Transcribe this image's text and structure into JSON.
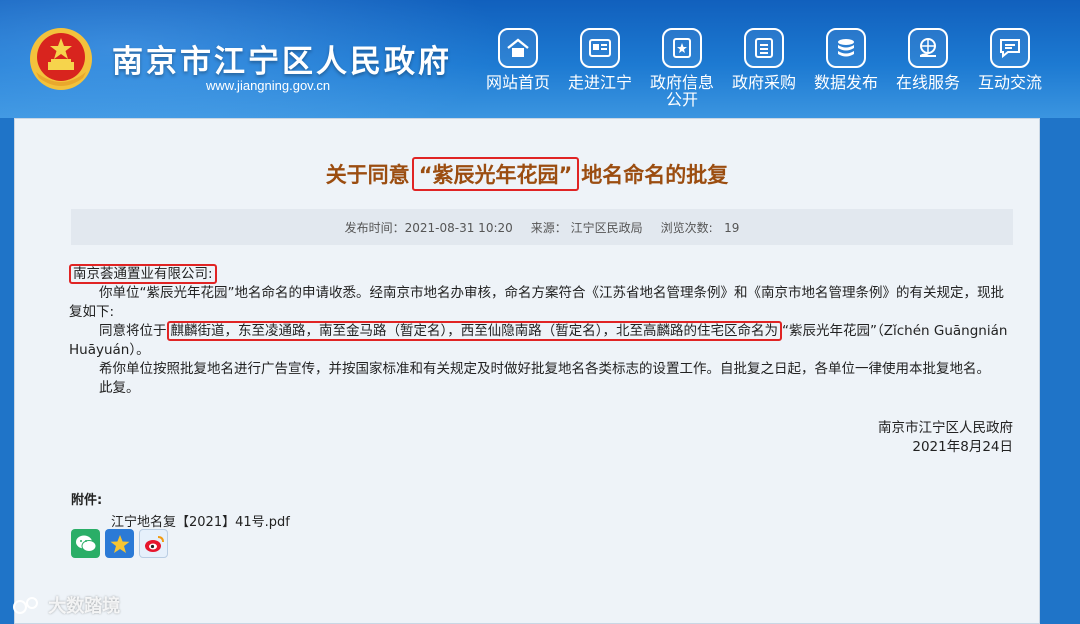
{
  "header": {
    "site_title": "南京市江宁区人民政府",
    "site_url": "www.jiangning.gov.cn",
    "nav": [
      {
        "label": "网站首页",
        "icon": "home-icon"
      },
      {
        "label": "走进江宁",
        "icon": "info-card-icon"
      },
      {
        "label": "政府信息公开",
        "icon": "open-info-icon"
      },
      {
        "label": "政府采购",
        "icon": "list-icon"
      },
      {
        "label": "数据发布",
        "icon": "database-icon"
      },
      {
        "label": "在线服务",
        "icon": "globe-hand-icon"
      },
      {
        "label": "互动交流",
        "icon": "chat-icon"
      }
    ]
  },
  "article": {
    "title_before": "关于同意",
    "title_highlight": "“紫辰光年花园”",
    "title_after": "地名命名的批复",
    "meta": {
      "publish_time": "发布时间：2021-08-31 10:20",
      "source": "来源：  江宁区民政局",
      "views_label": "浏览次数:",
      "views": "19"
    },
    "addressee": "南京荟通置业有限公司:",
    "p1": "你单位“紫辰光年花园”地名命名的申请收悉。经南京市地名办审核，命名方案符合《江苏省地名管理条例》和《南京市地名管理条例》的有关规定，现批复如下:",
    "p2_before": "同意将位于",
    "p2_highlight": "麒麟街道，东至凌通路，南至金马路（暂定名），西至仙隐南路（暂定名），北至高麟路的住宅区命名为",
    "p2_after": "“紫辰光年花园”（Zǐchén Guāngnián Huāyuán）。",
    "p3": "希你单位按照批复地名进行广告宣传，并按国家标准和有关规定及时做好批复地名各类标志的设置工作。自批复之日起，各单位一律使用本批复地名。",
    "p4": "此复。",
    "sign_org": "南京市江宁区人民政府",
    "sign_date": "2021年8月24日",
    "attachment_heading": "附件:",
    "attachment_file": "江宁地名复【2021】41号.pdf"
  },
  "share": [
    {
      "icon": "wechat-icon",
      "color": "#2aae67"
    },
    {
      "icon": "qzone-star-icon",
      "color": "#2b7ad6"
    },
    {
      "icon": "weibo-icon",
      "color": "#e6f0fb"
    }
  ],
  "watermark": "大数踏境",
  "colors": {
    "header": "#1d7ad2",
    "title": "#9b4d10",
    "highlight": "#e02424"
  }
}
